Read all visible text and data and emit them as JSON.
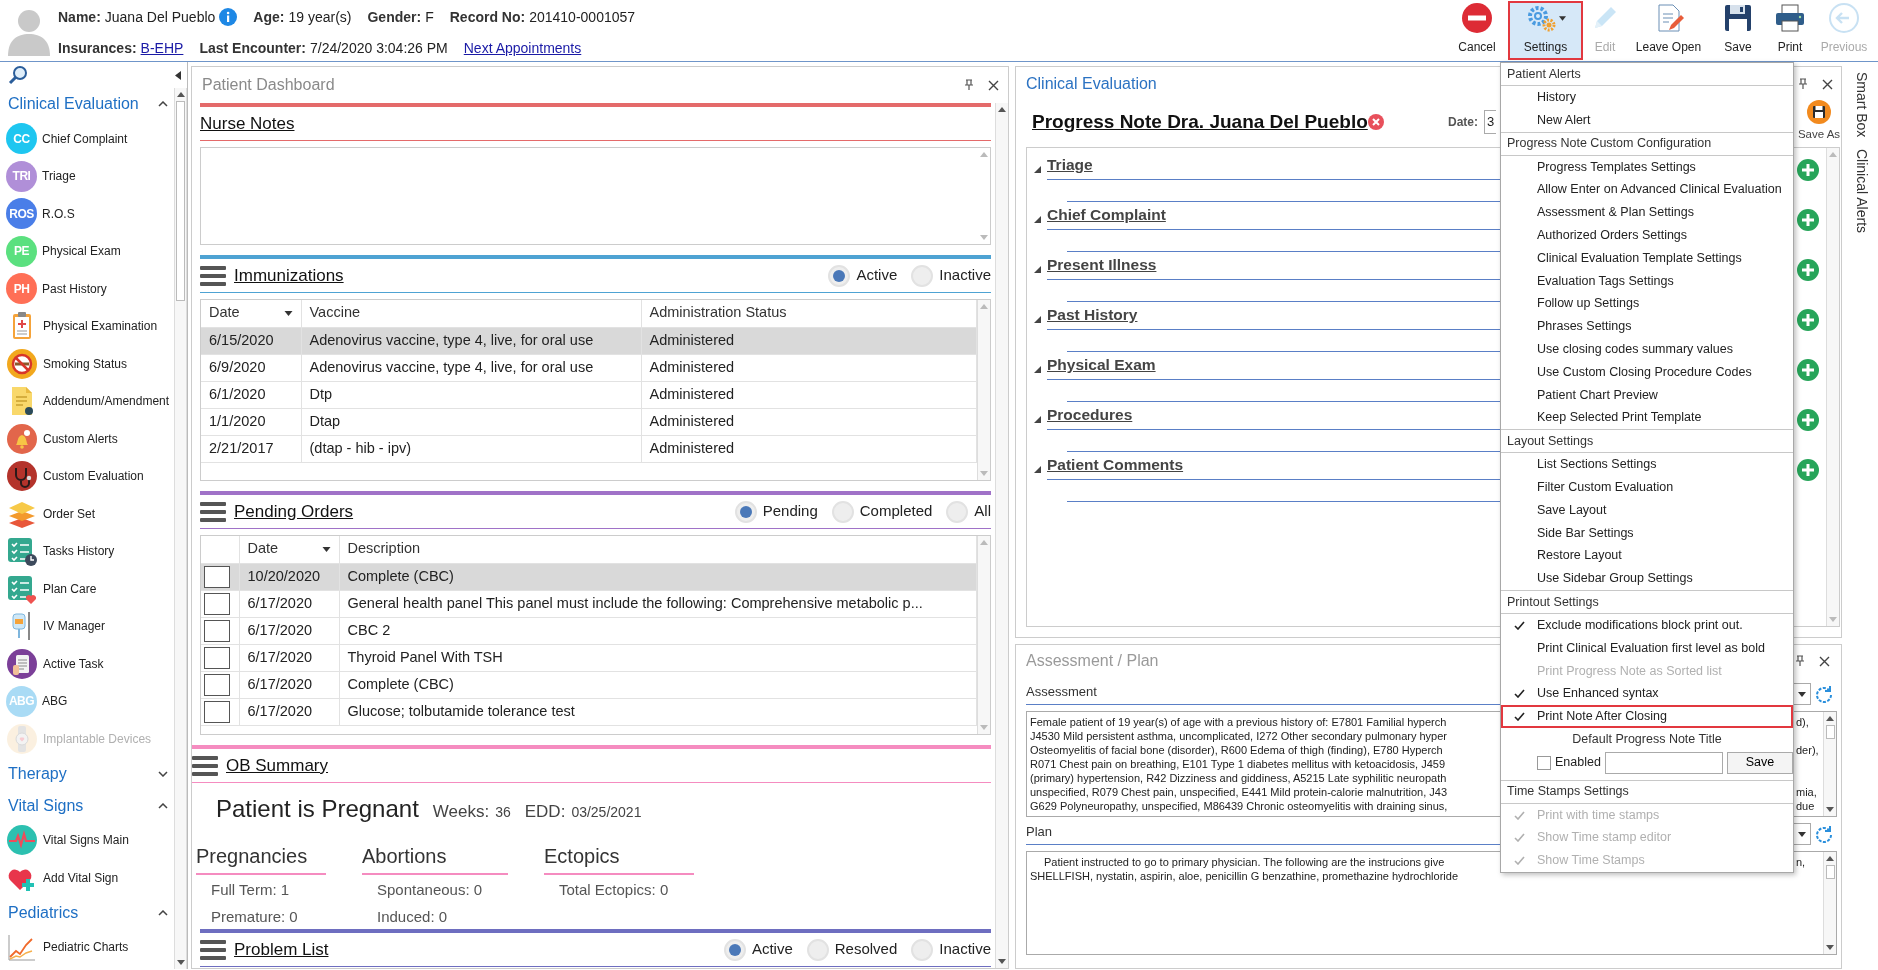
{
  "header": {
    "lines": [
      {
        "fields": [
          {
            "label": "Name:",
            "value": "Juana Del Pueblo",
            "kind": "text",
            "info": true
          },
          {
            "label": "Age:",
            "value": "19 year(s)",
            "kind": "text",
            "info": false
          },
          {
            "label": "Gender:",
            "value": "F",
            "kind": "text",
            "info": false
          },
          {
            "label": "Record No:",
            "value": "201410-0001057",
            "kind": "text",
            "info": false
          }
        ]
      },
      {
        "fields": [
          {
            "label": "Insurances:",
            "value": "B-EHP",
            "kind": "link",
            "info": false
          },
          {
            "label": "Last Encounter:",
            "value": "7/24/2020 3:04:26 PM",
            "kind": "text",
            "info": false
          },
          {
            "value": "Next Appointments",
            "kind": "link",
            "info": false
          }
        ]
      }
    ]
  },
  "toolbar": [
    {
      "label": "Cancel",
      "disabled": false,
      "selected": false,
      "highlighted": false,
      "dropdown": false
    },
    {
      "label": "Settings",
      "disabled": false,
      "selected": true,
      "highlighted": true,
      "dropdown": true
    },
    {
      "label": "Edit",
      "disabled": true,
      "selected": false,
      "highlighted": false,
      "dropdown": false
    },
    {
      "label": "Leave Open",
      "disabled": false,
      "selected": false,
      "highlighted": false,
      "dropdown": false
    },
    {
      "label": "Save",
      "disabled": false,
      "selected": false,
      "highlighted": false,
      "dropdown": false
    },
    {
      "label": "Print",
      "disabled": false,
      "selected": false,
      "highlighted": false,
      "dropdown": false
    },
    {
      "label": "Previous",
      "disabled": true,
      "selected": false,
      "highlighted": false,
      "dropdown": false
    }
  ],
  "sidebar": {
    "groups": [
      {
        "title": "Clinical Evaluation",
        "expanded": true,
        "items": [
          {
            "label": "Chief Complaint",
            "kind": "badge",
            "badge": "CC",
            "color": "#1ec6f0",
            "disabled": false
          },
          {
            "label": "Triage",
            "kind": "badge",
            "badge": "TRI",
            "color": "#b08fd8",
            "disabled": false
          },
          {
            "label": "R.O.S",
            "kind": "badge",
            "badge": "ROS",
            "color": "#4a7ee8",
            "disabled": false
          },
          {
            "label": "Physical Exam",
            "kind": "badge",
            "badge": "PE",
            "color": "#5be07f",
            "disabled": false
          },
          {
            "label": "Past History",
            "kind": "badge",
            "badge": "PH",
            "color": "#ff6f56",
            "disabled": false
          },
          {
            "label": "Physical Examination",
            "kind": "icon",
            "disabled": false
          },
          {
            "label": "Smoking Status",
            "kind": "icon",
            "disabled": false
          },
          {
            "label": "Addendum/Amendment",
            "kind": "icon",
            "disabled": false
          },
          {
            "label": "Custom Alerts",
            "kind": "icon",
            "disabled": false
          },
          {
            "label": "Custom Evaluation",
            "kind": "icon",
            "disabled": false
          },
          {
            "label": "Order Set",
            "kind": "icon",
            "disabled": false
          },
          {
            "label": "Tasks History",
            "kind": "icon",
            "disabled": false
          },
          {
            "label": "Plan Care",
            "kind": "icon",
            "disabled": false
          },
          {
            "label": "IV Manager",
            "kind": "icon",
            "disabled": false
          },
          {
            "label": "Active Task",
            "kind": "icon",
            "disabled": false
          },
          {
            "label": "ABG",
            "kind": "badge",
            "badge": "ABG",
            "color": "#a9dbf5",
            "disabled": false
          },
          {
            "label": "Implantable Devices",
            "kind": "icon",
            "disabled": true
          }
        ]
      },
      {
        "title": "Therapy",
        "expanded": false
      },
      {
        "title": "Vital Signs",
        "expanded": true,
        "items": [
          {
            "label": "Vital Signs Main",
            "kind": "icon",
            "disabled": false
          },
          {
            "label": "Add Vital Sign",
            "kind": "icon",
            "disabled": false
          }
        ]
      },
      {
        "title": "Pediatrics",
        "expanded": true,
        "items": [
          {
            "label": "Pediatric Charts",
            "kind": "icon",
            "disabled": false
          }
        ]
      }
    ]
  },
  "patient_dashboard": {
    "title": "Patient Dashboard",
    "sections": [
      {
        "kind": "notes",
        "title": "Nurse Notes",
        "color": "#e46a6a"
      },
      {
        "kind": "table",
        "title": "Immunizations",
        "color": "#4ea3d3",
        "filters": [
          {
            "label": "Active",
            "selected": true
          },
          {
            "label": "Inactive",
            "selected": false
          }
        ],
        "columns": [
          {
            "label": "Date",
            "sorted": true
          },
          {
            "label": "Vaccine",
            "sorted": false
          },
          {
            "label": "Administration Status",
            "sorted": false
          }
        ],
        "rows": [
          {
            "cells": [
              "6/15/2020",
              "Adenovirus vaccine, type 4, live, for oral use",
              "Administered"
            ],
            "selected": true
          },
          {
            "cells": [
              "6/9/2020",
              "Adenovirus vaccine, type 4, live, for oral use",
              "Administered"
            ],
            "selected": false
          },
          {
            "cells": [
              "6/1/2020",
              "Dtp",
              "Administered"
            ],
            "selected": false
          },
          {
            "cells": [
              "1/1/2020",
              "Dtap",
              "Administered"
            ],
            "selected": false
          },
          {
            "cells": [
              "2/21/2017",
              "(dtap - hib - ipv)",
              "Administered"
            ],
            "selected": false
          }
        ]
      },
      {
        "kind": "table",
        "title": "Pending Orders",
        "color": "#a072c8",
        "filters": [
          {
            "label": "Pending",
            "selected": true
          },
          {
            "label": "Completed",
            "selected": false
          },
          {
            "label": "All",
            "selected": false
          }
        ],
        "columns": [
          {
            "label": "Date",
            "sorted": true
          },
          {
            "label": "Description",
            "sorted": false
          }
        ],
        "rows": [
          {
            "cells": [
              "10/20/2020",
              "Complete (CBC)"
            ],
            "selected": true,
            "checked": false
          },
          {
            "cells": [
              "6/17/2020",
              "General health panel This panel must include the following: Comprehensive metabolic p..."
            ],
            "selected": false,
            "checked": false
          },
          {
            "cells": [
              "6/17/2020",
              "CBC 2"
            ],
            "selected": false,
            "checked": false
          },
          {
            "cells": [
              "6/17/2020",
              "Thyroid Panel With TSH"
            ],
            "selected": false,
            "checked": false
          },
          {
            "cells": [
              "6/17/2020",
              "Complete (CBC)"
            ],
            "selected": false,
            "checked": false
          },
          {
            "cells": [
              "6/17/2020",
              "Glucose; tolbutamide tolerance test"
            ],
            "selected": false,
            "checked": false
          }
        ]
      },
      {
        "kind": "ob_summary",
        "title": "OB Summary",
        "color": "#f58cc0",
        "status": "Patient is Pregnant",
        "weeks_label": "Weeks:",
        "weeks": "36",
        "edd_label": "EDD:",
        "edd": "03/25/2021",
        "groups": [
          {
            "title": "Pregnancies",
            "lines": [
              "Full Term: 1",
              "Premature: 0"
            ]
          },
          {
            "title": "Abortions",
            "lines": [
              "Spontaneous: 0",
              "Induced: 0"
            ]
          },
          {
            "title": "Ectopics",
            "lines": [
              "Total Ectopics: 0"
            ]
          }
        ]
      },
      {
        "kind": "header",
        "title": "Problem List",
        "color": "#6e6ec0",
        "filters": [
          {
            "label": "Active",
            "selected": true
          },
          {
            "label": "Resolved",
            "selected": false
          },
          {
            "label": "Inactive",
            "selected": false
          }
        ]
      }
    ]
  },
  "clinical_evaluation": {
    "title": "Clinical Evaluation",
    "note_title": "Progress Note Dra. Juana Del Pueblo",
    "date_label": "Date:",
    "date_value": "3",
    "save_as": "Save As",
    "sections": [
      {
        "title": "Triage",
        "expanded": true
      },
      {
        "title": "Chief Complaint",
        "expanded": true
      },
      {
        "title": "Present Illness",
        "expanded": true
      },
      {
        "title": "Past History",
        "expanded": true
      },
      {
        "title": "Physical Exam",
        "expanded": true
      },
      {
        "title": "Procedures",
        "expanded": true
      },
      {
        "title": "Patient Comments",
        "expanded": true
      }
    ]
  },
  "assessment_plan": {
    "title": "Assessment / Plan",
    "assessment_label": "Assessment",
    "assessment_lines": [
      {
        "text": "Female patient of 19 year(s) of age  with a previous history of: E7801 Familial hyperch",
        "tail": "d),"
      },
      {
        "text": "J4530 Mild persistent asthma, uncomplicated, I272 Other secondary pulmonary hyper"
      },
      {
        "text": "Osteomyelitis of facial bone (disorder), R600 Edema of thigh (finding), E780 Hyperch",
        "tail": "der),"
      },
      {
        "text": "R071 Chest pain on breathing, E101 Type 1 diabetes mellitus with ketoacidosis, J459"
      },
      {
        "text": "(primary) hypertension, R42 Dizziness and giddiness, A5215 Late syphilitic neuropath"
      },
      {
        "text": "unspecified, R079 Chest pain, unspecified, E441 Mild protein-calorie malnutrition, J43",
        "tail": "mia,"
      },
      {
        "text": "G629 Polyneuropathy, unspecified, M86439 Chronic osteomyelitis with draining sinus,",
        "tail": "due"
      }
    ],
    "plan_label": "Plan",
    "plan_lines": [
      {
        "text": "Patient instructed to go to primary physician.  The following are the instrucions give",
        "tail": "n,"
      },
      {
        "text": "SHELLFISH, nystatin, aspirin, aloe, penicillin G benzathine, promethazine hydrochloride"
      }
    ]
  },
  "side_tabs": [
    "Smart Box",
    "Clinical Alerts"
  ],
  "settings_menu": {
    "sections": [
      {
        "header": "Patient Alerts",
        "items": [
          {
            "label": "History",
            "checked": false,
            "disabled": false,
            "highlighted": false
          },
          {
            "label": "New Alert",
            "checked": false,
            "disabled": false,
            "highlighted": false
          }
        ]
      },
      {
        "header": "Progress Note Custom Configuration",
        "items": [
          {
            "label": "Progress Templates Settings",
            "checked": false,
            "disabled": false,
            "highlighted": false
          },
          {
            "label": "Allow Enter on Advanced Clinical Evaluation",
            "checked": false,
            "disabled": false,
            "highlighted": false
          },
          {
            "label": "Assessment & Plan Settings",
            "checked": false,
            "disabled": false,
            "highlighted": false
          },
          {
            "label": "Authorized Orders Settings",
            "checked": false,
            "disabled": false,
            "highlighted": false
          },
          {
            "label": "Clinical Evaluation Template Settings",
            "checked": false,
            "disabled": false,
            "highlighted": false
          },
          {
            "label": "Evaluation Tags Settings",
            "checked": false,
            "disabled": false,
            "highlighted": false
          },
          {
            "label": "Follow up Settings",
            "checked": false,
            "disabled": false,
            "highlighted": false
          },
          {
            "label": "Phrases Settings",
            "checked": false,
            "disabled": false,
            "highlighted": false
          },
          {
            "label": "Use closing codes summary values",
            "checked": false,
            "disabled": false,
            "highlighted": false
          },
          {
            "label": "Use Custom Closing Procedure Codes",
            "checked": false,
            "disabled": false,
            "highlighted": false
          },
          {
            "label": "Patient Chart Preview",
            "checked": false,
            "disabled": false,
            "highlighted": false
          },
          {
            "label": "Keep Selected Print Template",
            "checked": false,
            "disabled": false,
            "highlighted": false
          }
        ]
      },
      {
        "header": "Layout Settings",
        "items": [
          {
            "label": "List Sections Settings",
            "checked": false,
            "disabled": false,
            "highlighted": false
          },
          {
            "label": "Filter Custom Evaluation",
            "checked": false,
            "disabled": false,
            "highlighted": false
          },
          {
            "label": "Save Layout",
            "checked": false,
            "disabled": false,
            "highlighted": false
          },
          {
            "label": "Side Bar Settings",
            "checked": false,
            "disabled": false,
            "highlighted": false
          },
          {
            "label": "Restore Layout",
            "checked": false,
            "disabled": false,
            "highlighted": false
          },
          {
            "label": "Use Sidebar Group Settings",
            "checked": false,
            "disabled": false,
            "highlighted": false
          }
        ]
      },
      {
        "header": "Printout Settings",
        "items": [
          {
            "label": "Exclude modifications block print out.",
            "checked": true,
            "disabled": false,
            "highlighted": false
          },
          {
            "label": "Print Clinical Evaluation first level as bold",
            "checked": false,
            "disabled": false,
            "highlighted": false
          },
          {
            "label": "Print Progress Note as Sorted list",
            "checked": false,
            "disabled": true,
            "highlighted": false
          },
          {
            "label": "Use Enhanced syntax",
            "checked": true,
            "disabled": false,
            "highlighted": false
          },
          {
            "label": "Print Note After Closing",
            "checked": true,
            "disabled": false,
            "highlighted": true
          }
        ],
        "title_option": {
          "label": "Default Progress Note Title",
          "checkbox_label": "Enabled",
          "checked": false,
          "button": "Save"
        }
      },
      {
        "header": "Time Stamps Settings",
        "items": [
          {
            "label": "Print with time stamps",
            "checked": true,
            "disabled": true,
            "highlighted": false
          },
          {
            "label": "Show Time stamp editor",
            "checked": true,
            "disabled": true,
            "highlighted": false
          },
          {
            "label": "Show Time Stamps",
            "checked": true,
            "disabled": true,
            "highlighted": false
          }
        ]
      }
    ]
  }
}
